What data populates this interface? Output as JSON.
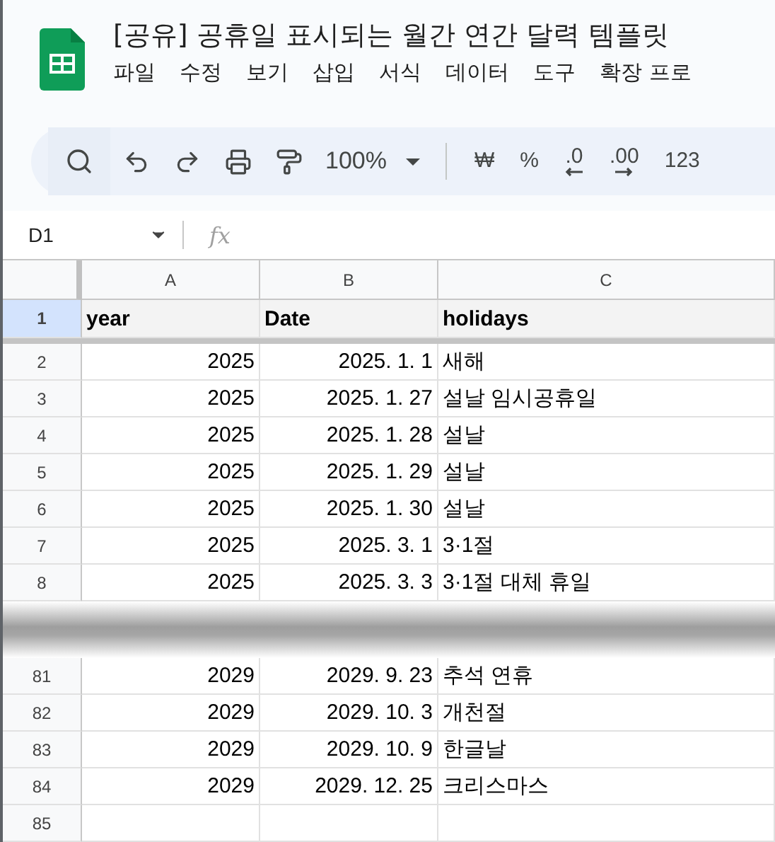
{
  "title": "[공유] 공휴일 표시되는 월간 연간 달력 템플릿",
  "menu": [
    "파일",
    "수정",
    "보기",
    "삽입",
    "서식",
    "데이터",
    "도구",
    "확장 프로"
  ],
  "toolbar": [
    {
      "kind": "search"
    },
    {
      "kind": "undo"
    },
    {
      "kind": "redo"
    },
    {
      "kind": "print"
    },
    {
      "kind": "paint"
    },
    {
      "kind": "zoom",
      "label": "100%"
    },
    {
      "kind": "divider"
    },
    {
      "kind": "text",
      "label": "₩"
    },
    {
      "kind": "text",
      "label": "%"
    },
    {
      "kind": "decrease",
      "label": ".0"
    },
    {
      "kind": "increase",
      "label": ".00"
    },
    {
      "kind": "text",
      "label": "123"
    }
  ],
  "name_box": "D1",
  "formula_icon": "fx",
  "columns": [
    "A",
    "B",
    "C"
  ],
  "header_row": {
    "number": "1",
    "selected": true,
    "cells": [
      "year",
      "Date",
      "holidays"
    ]
  },
  "rows": [
    {
      "kind": "row",
      "number": "2",
      "year": "2025",
      "date": "2025. 1. 1",
      "holiday": "새해"
    },
    {
      "kind": "row",
      "number": "3",
      "year": "2025",
      "date": "2025. 1. 27",
      "holiday": "설날 임시공휴일"
    },
    {
      "kind": "row",
      "number": "4",
      "year": "2025",
      "date": "2025. 1. 28",
      "holiday": "설날"
    },
    {
      "kind": "row",
      "number": "5",
      "year": "2025",
      "date": "2025. 1. 29",
      "holiday": "설날"
    },
    {
      "kind": "row",
      "number": "6",
      "year": "2025",
      "date": "2025. 1. 30",
      "holiday": "설날"
    },
    {
      "kind": "row",
      "number": "7",
      "year": "2025",
      "date": "2025. 3. 1",
      "holiday": "3·1절"
    },
    {
      "kind": "row",
      "number": "8",
      "year": "2025",
      "date": "2025. 3. 3",
      "holiday": "3·1절 대체 휴일"
    },
    {
      "kind": "gap"
    },
    {
      "kind": "row",
      "number": "81",
      "year": "2029",
      "date": "2029. 9. 23",
      "holiday": "추석 연휴"
    },
    {
      "kind": "row",
      "number": "82",
      "year": "2029",
      "date": "2029. 10. 3",
      "holiday": "개천절"
    },
    {
      "kind": "row",
      "number": "83",
      "year": "2029",
      "date": "2029. 10. 9",
      "holiday": "한글날"
    },
    {
      "kind": "row",
      "number": "84",
      "year": "2029",
      "date": "2029. 12. 25",
      "holiday": "크리스마스"
    },
    {
      "kind": "row",
      "number": "85"
    }
  ]
}
